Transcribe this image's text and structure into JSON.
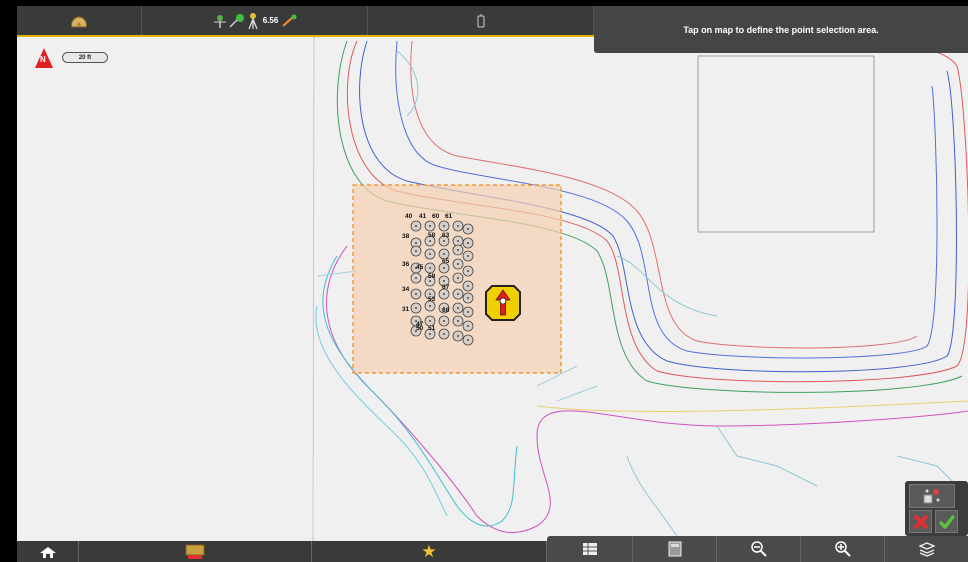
{
  "top": {
    "home_icon": "home-cloud-icon",
    "gps_value": "6.56",
    "status_icons": [
      "satellite-icon",
      "connection-icon",
      "tripod-icon",
      "rover-icon"
    ],
    "device_icon": "device-icon"
  },
  "banner": {
    "text": "Tap on map to define the point selection area."
  },
  "map": {
    "north_label": "N",
    "scale_label": "20 ft",
    "selection_fill": "#f5d0b0",
    "selection_border": "#f08a18",
    "point_labels": [
      "40",
      "41",
      "60",
      "61",
      "38",
      "58",
      "63",
      "36",
      "45",
      "65",
      "59",
      "34",
      "67",
      "31",
      "47",
      "53",
      "68",
      "50",
      "51"
    ]
  },
  "bottom": {
    "items": [
      "home-icon",
      "map-layers-icon",
      "favorite-star-icon",
      "table-icon",
      "calculator-icon",
      "zoom-out-icon",
      "zoom-in-icon",
      "layers-icon"
    ]
  },
  "panel": {
    "icons": [
      "point-select-icon",
      "cancel-icon",
      "accept-icon"
    ]
  },
  "colors": {
    "accent": "#e0b400",
    "bar": "#3a3a3a",
    "cancel": "#e03030",
    "accept": "#5ac040"
  }
}
